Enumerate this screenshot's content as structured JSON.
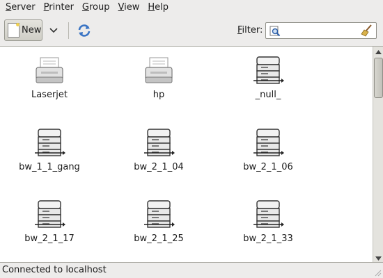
{
  "menubar": {
    "items": [
      {
        "first": "S",
        "rest": "erver"
      },
      {
        "first": "P",
        "rest": "rinter"
      },
      {
        "first": "G",
        "rest": "roup"
      },
      {
        "first": "V",
        "rest": "iew"
      },
      {
        "first": "H",
        "rest": "elp"
      }
    ]
  },
  "toolbar": {
    "new_label": "New",
    "new_icon": "new-document-icon",
    "dropdown_icon": "chevron-down-icon",
    "refresh_icon": "refresh-icon",
    "filter_label_first": "F",
    "filter_label_rest": "ilter:",
    "filter_value": "",
    "filter_search_icon": "search-icon",
    "filter_clear_icon": "clear-broom-icon"
  },
  "printers": [
    {
      "name": "Laserjet",
      "icon": "desktop-printer-icon"
    },
    {
      "name": "hp",
      "icon": "desktop-printer-icon"
    },
    {
      "name": "_null_",
      "icon": "printer-stack-icon"
    },
    {
      "name": "bw_1_1_gang",
      "icon": "printer-stack-icon"
    },
    {
      "name": "bw_2_1_04",
      "icon": "printer-stack-icon"
    },
    {
      "name": "bw_2_1_06",
      "icon": "printer-stack-icon"
    },
    {
      "name": "bw_2_1_17",
      "icon": "printer-stack-icon"
    },
    {
      "name": "bw_2_1_25",
      "icon": "printer-stack-icon"
    },
    {
      "name": "bw_2_1_33",
      "icon": "printer-stack-icon"
    }
  ],
  "status": {
    "text": "Connected to localhost"
  },
  "colors": {
    "window_bg": "#edeceb",
    "content_bg": "#ffffff",
    "refresh_blue": "#3a74c4"
  }
}
